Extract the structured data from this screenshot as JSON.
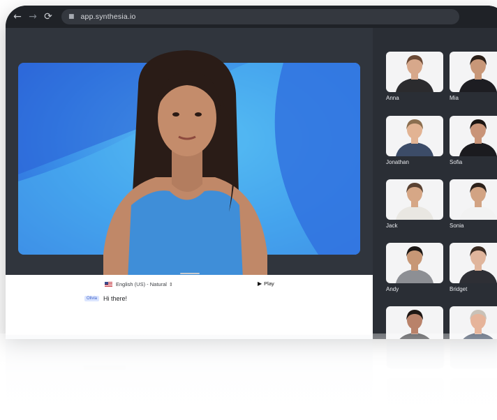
{
  "browser": {
    "url": "app.synthesia.io",
    "nav": {
      "back_icon": "←",
      "forward_icon": "→",
      "reload_icon": "⟳",
      "lock_icon": "🔒"
    }
  },
  "avatars": [
    {
      "name": "Anna",
      "shirt": "#2b2b2e",
      "skin": "#d7a88b",
      "hair": "#6b4a36"
    },
    {
      "name": "Mia",
      "shirt": "#1d1d22",
      "skin": "#c89778",
      "hair": "#2a1e18"
    },
    {
      "name": "Jonathan",
      "shirt": "#3c4c68",
      "skin": "#e2b393",
      "hair": "#8b6e4f"
    },
    {
      "name": "Sofia",
      "shirt": "#1b1b1f",
      "skin": "#c99478",
      "hair": "#1b1512"
    },
    {
      "name": "Jack",
      "shirt": "#e9e7e2",
      "skin": "#d6a786",
      "hair": "#5a4232"
    },
    {
      "name": "Sonia",
      "shirt": "#f2f2f2",
      "skin": "#d2a383",
      "hair": "#2c211b"
    },
    {
      "name": "Andy",
      "shirt": "#8d8f94",
      "skin": "#c79776",
      "hair": "#1a1614"
    },
    {
      "name": "Bridget",
      "shirt": "#2e2f35",
      "skin": "#e0b59c",
      "hair": "#3a2b22"
    },
    {
      "name": "",
      "shirt": "#2a2a2d",
      "skin": "#b9826a",
      "hair": "#1e1714"
    },
    {
      "name": "",
      "shirt": "#2b3a52",
      "skin": "#e6b49a",
      "hair": "#c9c2b8"
    }
  ],
  "editor": {
    "voice_label": "English (US) - Natural",
    "voice_caret": "⇕",
    "play_label": "Play",
    "play_icon": "▶",
    "speaker_chip": "Olivia",
    "script_text": "Hi there!"
  },
  "colors": {
    "browser_chrome": "#1f2227",
    "stage_bg": "#30353d",
    "panel_bg": "#2a2e35",
    "video_blue": "#3a8fe8",
    "presenter_dress": "#3f8ed8"
  }
}
